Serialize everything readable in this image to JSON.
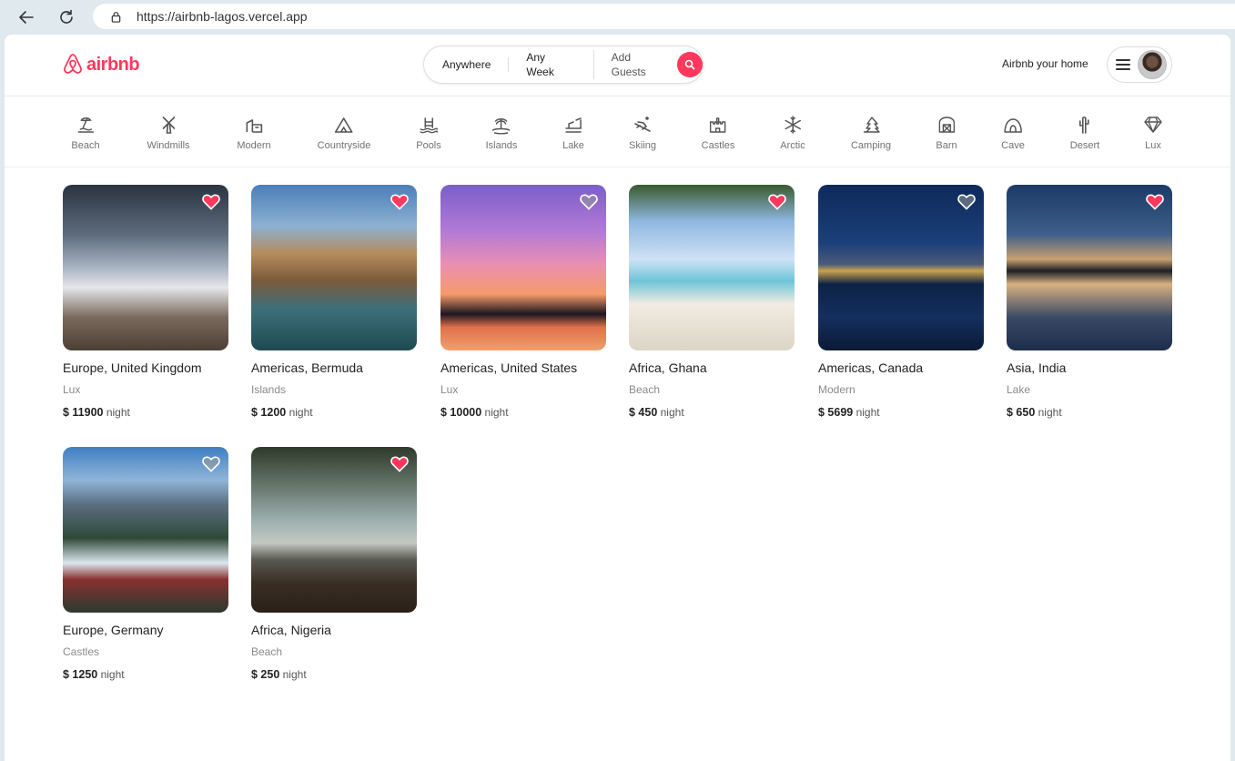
{
  "browser": {
    "url": "https://airbnb-lagos.vercel.app"
  },
  "header": {
    "logo_text": "airbnb",
    "search": {
      "where": "Anywhere",
      "when": "Any Week",
      "who": "Add Guests"
    },
    "host_link": "Airbnb your home"
  },
  "categories": [
    {
      "label": "Beach",
      "icon": "beach-icon"
    },
    {
      "label": "Windmills",
      "icon": "windmill-icon"
    },
    {
      "label": "Modern",
      "icon": "modern-house-icon"
    },
    {
      "label": "Countryside",
      "icon": "countryside-icon"
    },
    {
      "label": "Pools",
      "icon": "pool-icon"
    },
    {
      "label": "Islands",
      "icon": "island-icon"
    },
    {
      "label": "Lake",
      "icon": "lake-icon"
    },
    {
      "label": "Skiing",
      "icon": "skiing-icon"
    },
    {
      "label": "Castles",
      "icon": "castle-icon"
    },
    {
      "label": "Arctic",
      "icon": "snowflake-icon"
    },
    {
      "label": "Camping",
      "icon": "camping-icon"
    },
    {
      "label": "Barn",
      "icon": "barn-icon"
    },
    {
      "label": "Cave",
      "icon": "cave-icon"
    },
    {
      "label": "Desert",
      "icon": "cactus-icon"
    },
    {
      "label": "Lux",
      "icon": "diamond-icon"
    }
  ],
  "listings": [
    {
      "location": "Europe, United Kingdom",
      "category": "Lux",
      "price": "$ 11900",
      "unit": "night",
      "favorited": true
    },
    {
      "location": "Americas, Bermuda",
      "category": "Islands",
      "price": "$ 1200",
      "unit": "night",
      "favorited": true
    },
    {
      "location": "Americas, United States",
      "category": "Lux",
      "price": "$ 10000",
      "unit": "night",
      "favorited": false
    },
    {
      "location": "Africa, Ghana",
      "category": "Beach",
      "price": "$ 450",
      "unit": "night",
      "favorited": true
    },
    {
      "location": "Americas, Canada",
      "category": "Modern",
      "price": "$ 5699",
      "unit": "night",
      "favorited": false
    },
    {
      "location": "Asia, India",
      "category": "Lake",
      "price": "$ 650",
      "unit": "night",
      "favorited": true
    },
    {
      "location": "Europe, Germany",
      "category": "Castles",
      "price": "$ 1250",
      "unit": "night",
      "favorited": false
    },
    {
      "location": "Africa, Nigeria",
      "category": "Beach",
      "price": "$ 250",
      "unit": "night",
      "favorited": true
    }
  ],
  "colors": {
    "brand": "#ff385c",
    "heart_active": "#ff385c",
    "heart_inactive": "#9a9a9a"
  }
}
